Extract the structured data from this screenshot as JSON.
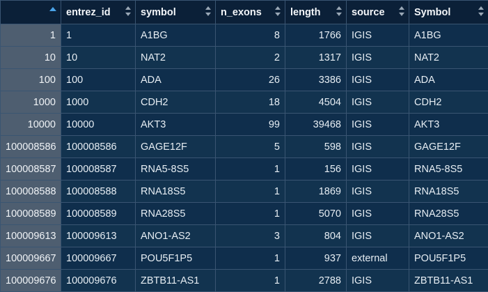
{
  "columns": [
    {
      "key": "rowname",
      "label": ""
    },
    {
      "key": "entrez_id",
      "label": "entrez_id"
    },
    {
      "key": "symbol",
      "label": "symbol"
    },
    {
      "key": "n_exons",
      "label": "n_exons"
    },
    {
      "key": "length",
      "label": "length"
    },
    {
      "key": "source",
      "label": "source"
    },
    {
      "key": "Symbol",
      "label": "Symbol"
    }
  ],
  "rows": [
    {
      "rowname": "1",
      "entrez_id": "1",
      "symbol": "A1BG",
      "n_exons": "8",
      "length": "1766",
      "source": "IGIS",
      "Symbol": "A1BG"
    },
    {
      "rowname": "10",
      "entrez_id": "10",
      "symbol": "NAT2",
      "n_exons": "2",
      "length": "1317",
      "source": "IGIS",
      "Symbol": "NAT2"
    },
    {
      "rowname": "100",
      "entrez_id": "100",
      "symbol": "ADA",
      "n_exons": "26",
      "length": "3386",
      "source": "IGIS",
      "Symbol": "ADA"
    },
    {
      "rowname": "1000",
      "entrez_id": "1000",
      "symbol": "CDH2",
      "n_exons": "18",
      "length": "4504",
      "source": "IGIS",
      "Symbol": "CDH2"
    },
    {
      "rowname": "10000",
      "entrez_id": "10000",
      "symbol": "AKT3",
      "n_exons": "99",
      "length": "39468",
      "source": "IGIS",
      "Symbol": "AKT3"
    },
    {
      "rowname": "100008586",
      "entrez_id": "100008586",
      "symbol": "GAGE12F",
      "n_exons": "5",
      "length": "598",
      "source": "IGIS",
      "Symbol": "GAGE12F"
    },
    {
      "rowname": "100008587",
      "entrez_id": "100008587",
      "symbol": "RNA5-8S5",
      "n_exons": "1",
      "length": "156",
      "source": "IGIS",
      "Symbol": "RNA5-8S5"
    },
    {
      "rowname": "100008588",
      "entrez_id": "100008588",
      "symbol": "RNA18S5",
      "n_exons": "1",
      "length": "1869",
      "source": "IGIS",
      "Symbol": "RNA18S5"
    },
    {
      "rowname": "100008589",
      "entrez_id": "100008589",
      "symbol": "RNA28S5",
      "n_exons": "1",
      "length": "5070",
      "source": "IGIS",
      "Symbol": "RNA28S5"
    },
    {
      "rowname": "100009613",
      "entrez_id": "100009613",
      "symbol": "ANO1-AS2",
      "n_exons": "3",
      "length": "804",
      "source": "IGIS",
      "Symbol": "ANO1-AS2"
    },
    {
      "rowname": "100009667",
      "entrez_id": "100009667",
      "symbol": "POU5F1P5",
      "n_exons": "1",
      "length": "937",
      "source": "external",
      "Symbol": "POU5F1P5"
    },
    {
      "rowname": "100009676",
      "entrez_id": "100009676",
      "symbol": "ZBTB11-AS1",
      "n_exons": "1",
      "length": "2788",
      "source": "IGIS",
      "Symbol": "ZBTB11-AS1"
    }
  ],
  "icons": {
    "sort_active": "sort-ascending-icon",
    "sort": "sort-toggle-icon"
  },
  "colors": {
    "background": "#0e2a45",
    "rowname_bg": "#4e5e70",
    "accent": "#4aa3e8"
  }
}
